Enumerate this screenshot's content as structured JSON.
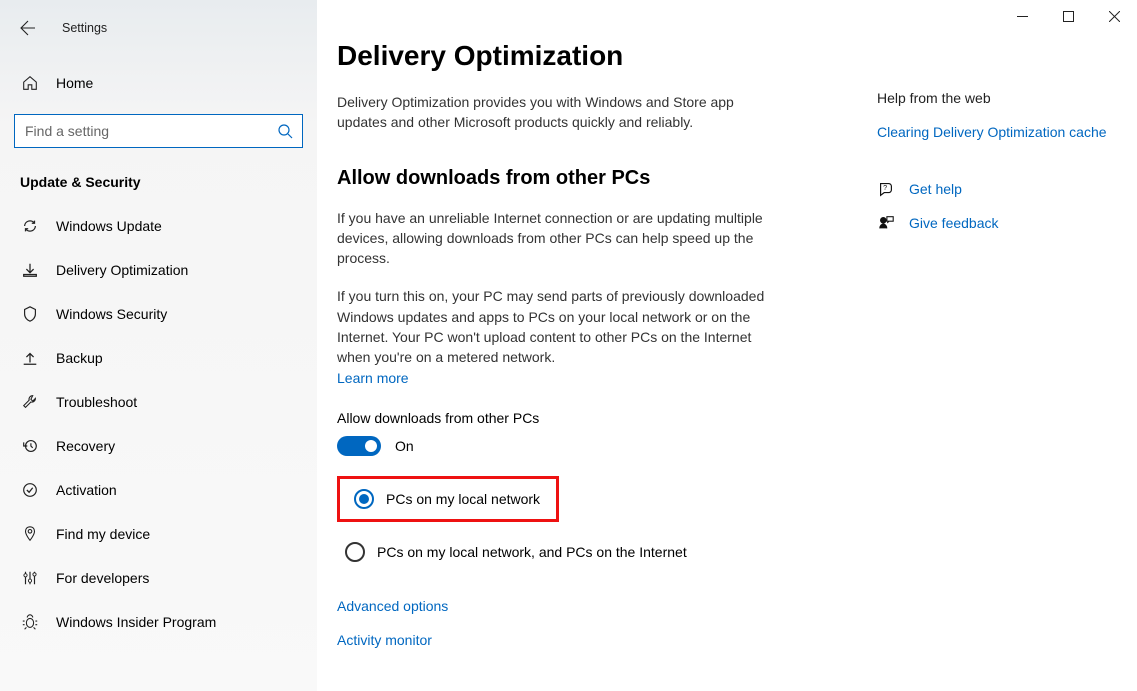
{
  "app_title": "Settings",
  "home_label": "Home",
  "search_placeholder": "Find a setting",
  "group_title": "Update & Security",
  "nav": [
    {
      "label": "Windows Update"
    },
    {
      "label": "Delivery Optimization"
    },
    {
      "label": "Windows Security"
    },
    {
      "label": "Backup"
    },
    {
      "label": "Troubleshoot"
    },
    {
      "label": "Recovery"
    },
    {
      "label": "Activation"
    },
    {
      "label": "Find my device"
    },
    {
      "label": "For developers"
    },
    {
      "label": "Windows Insider Program"
    }
  ],
  "page": {
    "title": "Delivery Optimization",
    "intro": "Delivery Optimization provides you with Windows and Store app updates and other Microsoft products quickly and reliably.",
    "section_title": "Allow downloads from other PCs",
    "para1": "If you have an unreliable Internet connection or are updating multiple devices, allowing downloads from other PCs can help speed up the process.",
    "para2": "If you turn this on, your PC may send parts of previously downloaded Windows updates and apps to PCs on your local network or on the Internet. Your PC won't upload content to other PCs on the Internet when you're on a metered network.",
    "learn_more": "Learn more",
    "toggle_label": "Allow downloads from other PCs",
    "toggle_state": "On",
    "radio1": "PCs on my local network",
    "radio2": "PCs on my local network, and PCs on the Internet",
    "adv_options": "Advanced options",
    "activity_monitor": "Activity monitor"
  },
  "right": {
    "help_header": "Help from the web",
    "help_link": "Clearing Delivery Optimization cache",
    "get_help": "Get help",
    "give_feedback": "Give feedback"
  }
}
